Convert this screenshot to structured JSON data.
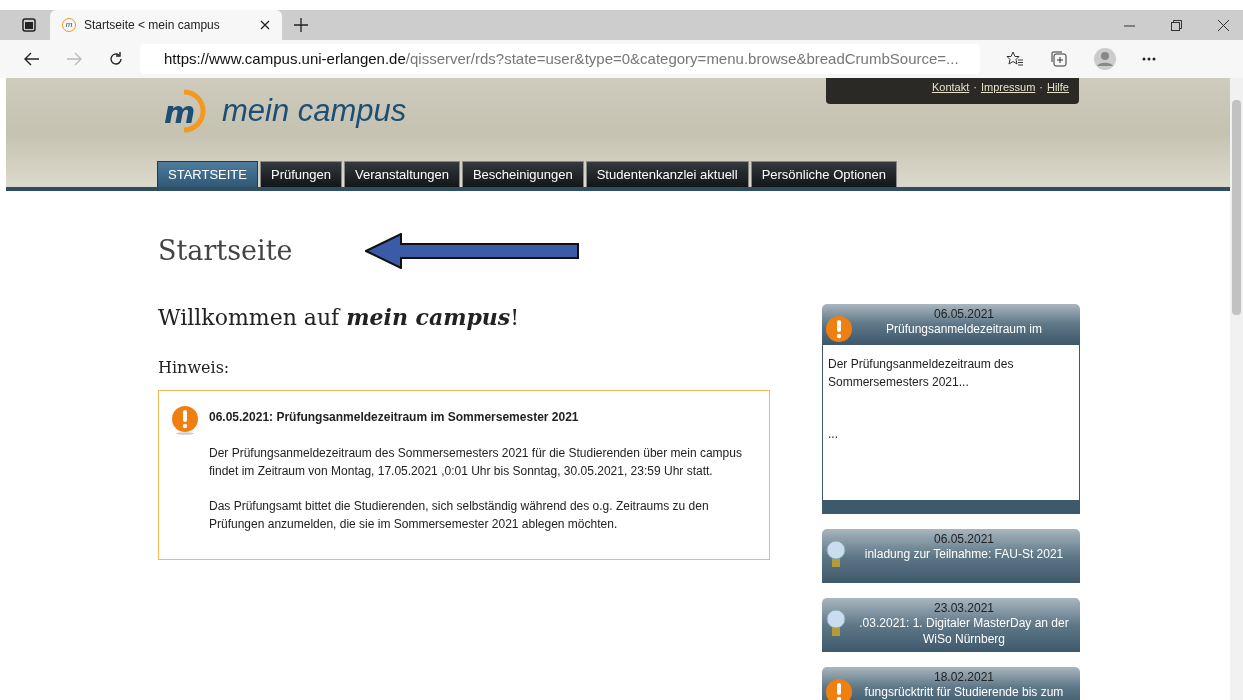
{
  "browser": {
    "tab_title": "Startseite < mein campus",
    "url_host": "https://www.campus.uni-erlangen.de",
    "url_path": "/qisserver/rds?state=user&type=0&category=menu.browse&breadCrumbSource=..."
  },
  "header": {
    "favicon_mark": "m",
    "logo_mark": "m",
    "logo_text": "mein campus",
    "links": [
      "Kontakt",
      "Impressum",
      "Hilfe"
    ],
    "separator": "·"
  },
  "nav": [
    {
      "label": "STARTSEITE",
      "selected": true
    },
    {
      "label": "Prüfungen",
      "selected": false
    },
    {
      "label": "Veranstaltungen",
      "selected": false
    },
    {
      "label": "Bescheinigungen",
      "selected": false
    },
    {
      "label": "Studentenkanzlei aktuell",
      "selected": false
    },
    {
      "label": "Persönliche Optionen",
      "selected": false
    }
  ],
  "page_title": "Startseite",
  "welcome": "Willkommen auf **mein campus**!",
  "notice_label": "Hinweis:",
  "notice": {
    "title": "06.05.2021: Prüfungsanmeldezeitraum im Sommersemester 2021",
    "paragraphs": [
      "Der Prüfungsanmeldezeitraum des Sommersemesters 2021 für die Studierenden über mein campus findet im Zeitraum von Montag, 17.05.2021 ,0:01 Uhr bis Sonntag, 30.05.2021, 23:59 Uhr statt.",
      "Das Prüfungsamt bittet die Studierenden, sich selbständig während des o.g. Zeitraums zu den Prüfungen anzumelden, die sie im Sommersemester 2021 ablegen möchten."
    ]
  },
  "news": [
    {
      "kind": "warning",
      "date": "06.05.2021",
      "title": "Prüfungsanmeldezeitraum im",
      "expanded": true,
      "body": "Der Prüfungsanmeldezeitraum des Sommersemesters 2021...",
      "more": "..."
    },
    {
      "kind": "bulb",
      "date": "06.05.2021",
      "title": "inladung zur Teilnahme: FAU-St 2021",
      "expanded": false
    },
    {
      "kind": "bulb",
      "date": "23.03.2021",
      "title": ".03.2021: 1. Digitaler MasterDay an der WiSo Nürnberg",
      "expanded": false
    },
    {
      "kind": "warning",
      "date": "18.02.2021",
      "title": "fungsrücktritt für Studierende bis zum",
      "expanded": false
    }
  ]
}
